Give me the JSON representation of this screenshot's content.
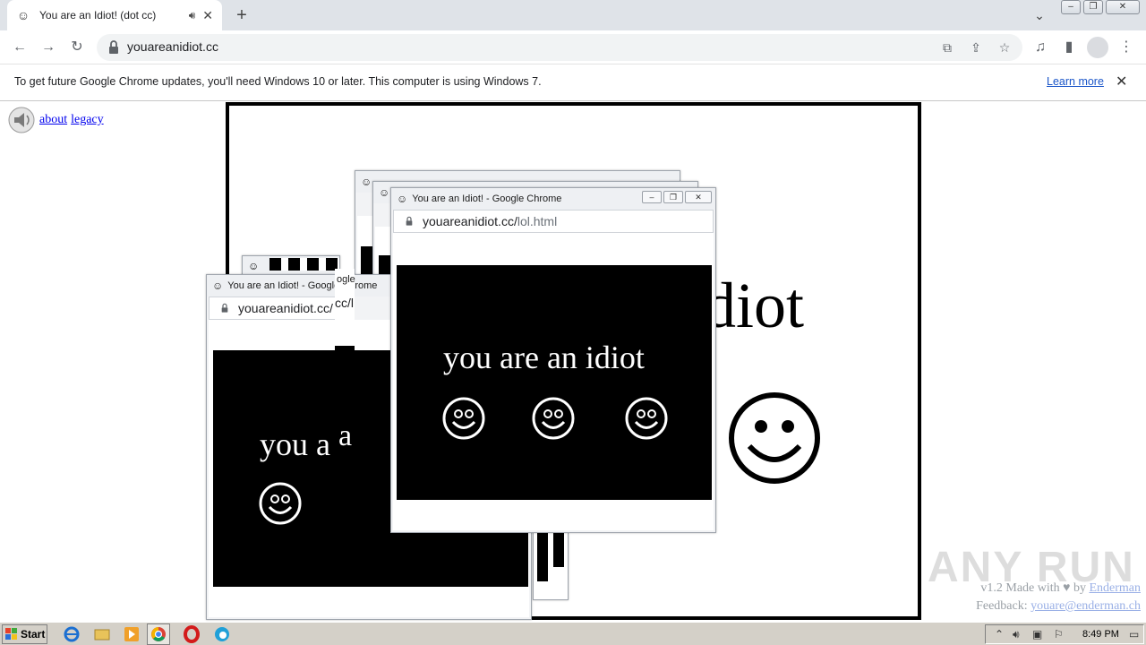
{
  "browser": {
    "tab": {
      "title": "You are an Idiot! (dot cc)"
    },
    "url": "youareanidiot.cc",
    "infobar": {
      "message": "To get future Google Chrome updates, you'll need Windows 10 or later. This computer is using Windows 7.",
      "learn_more": "Learn more"
    }
  },
  "page": {
    "links": [
      "about",
      "legacy"
    ],
    "big_text": "diot",
    "credit_prefix": "v1.2 Made with ",
    "credit_by": " by ",
    "credit_author": "Enderman",
    "feedback_label": "Feedback: ",
    "feedback_email": "youare@enderman.ch",
    "watermark": "ANY RUN"
  },
  "popups": [
    {
      "title": "You are an Idiot! - Google Chrome",
      "url": "youareanidiot.cc/",
      "url_path": "",
      "text": "you a"
    },
    {
      "title": "You are an Idiot! - Google Chrome",
      "url": "youareanidiot.cc/",
      "url_path": "lol.html",
      "text": "you are an idiot"
    }
  ],
  "popup_fragment_url": "cc/l",
  "popup_fragment_title": "ogle",
  "popup_fragment_text": "a",
  "taskbar": {
    "start": "Start",
    "time": "8:49 PM"
  },
  "colors": {
    "tab_strip": "#dfe3e8",
    "link_blue": "#0000ee",
    "taskbar": "#d4d0c8"
  }
}
